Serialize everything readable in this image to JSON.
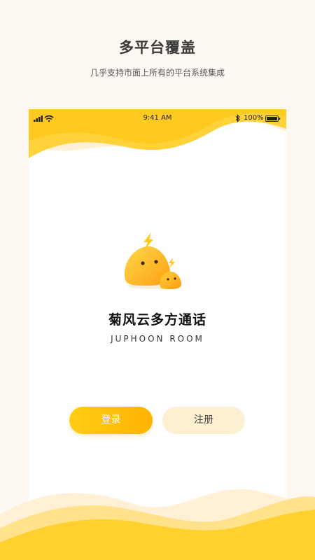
{
  "header": {
    "title": "多平台覆盖",
    "subtitle": "几乎支持市面上所有的平台系统集成"
  },
  "status_bar": {
    "time": "9:41 AM",
    "battery_percent": "100%"
  },
  "app": {
    "name": "菊风云多方通话",
    "name_en": "JUPHOON ROOM"
  },
  "buttons": {
    "login_label": "登录",
    "register_label": "注册"
  },
  "colors": {
    "accent_yellow": "#ffc61a",
    "accent_light": "#fdf0d2",
    "background": "#fdf8f2"
  },
  "icons": [
    "signal-icon",
    "wifi-icon",
    "bluetooth-icon",
    "battery-icon",
    "app-logo"
  ]
}
